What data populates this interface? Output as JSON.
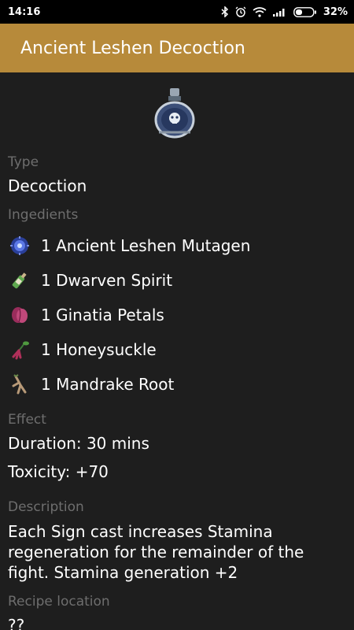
{
  "status": {
    "time": "14:16",
    "battery": "32%"
  },
  "appbar": {
    "title": "Ancient Leshen Decoction"
  },
  "sections": {
    "type_label": "Type",
    "type_value": "Decoction",
    "ingredients_label": "Ingedients",
    "ingredients": [
      {
        "label": "1 Ancient Leshen Mutagen",
        "icon": "mutagen-icon"
      },
      {
        "label": "1 Dwarven Spirit",
        "icon": "bottle-icon"
      },
      {
        "label": "1 Ginatia Petals",
        "icon": "petals-icon"
      },
      {
        "label": "1 Honeysuckle",
        "icon": "honeysuckle-icon"
      },
      {
        "label": "1 Mandrake Root",
        "icon": "root-icon"
      }
    ],
    "effect_label": "Effect",
    "duration": "Duration: 30 mins",
    "toxicity": "Toxicity: +70",
    "description_label": "Description",
    "description": "Each Sign cast increases Stamina regeneration for the remainder of the fight. Stamina generation +2",
    "recipe_label": "Recipe location",
    "recipe_value": "??"
  },
  "colors": {
    "appbar": "#b78a3a",
    "background": "#1e1e1e",
    "label": "#6e6e6e"
  }
}
